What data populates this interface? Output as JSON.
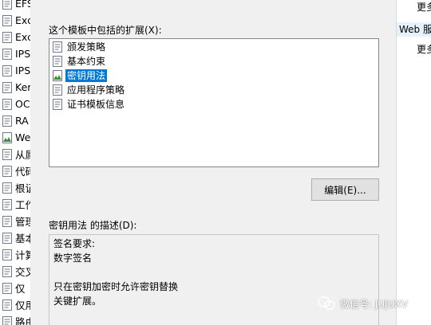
{
  "left_list": {
    "items": [
      {
        "label": "EFS",
        "icon": "certificate-template-icon"
      },
      {
        "label": "Exc",
        "icon": "certificate-template-icon"
      },
      {
        "label": "Exc",
        "icon": "certificate-template-icon"
      },
      {
        "label": "IPS",
        "icon": "certificate-template-icon"
      },
      {
        "label": "IPS",
        "icon": "certificate-template-icon"
      },
      {
        "label": "Ker",
        "icon": "certificate-template-icon"
      },
      {
        "label": "OC",
        "icon": "certificate-template-icon"
      },
      {
        "label": "RA",
        "icon": "certificate-template-icon"
      },
      {
        "label": "We",
        "icon": "certificate-template-icon"
      },
      {
        "label": "从属",
        "icon": "certificate-template-icon"
      },
      {
        "label": "代码",
        "icon": "certificate-template-icon"
      },
      {
        "label": "根证",
        "icon": "certificate-template-icon"
      },
      {
        "label": "工作",
        "icon": "certificate-template-icon"
      },
      {
        "label": "管理",
        "icon": "certificate-template-icon"
      },
      {
        "label": "基本",
        "icon": "certificate-template-icon"
      },
      {
        "label": "计算",
        "icon": "certificate-template-icon"
      },
      {
        "label": "交叉",
        "icon": "certificate-template-icon"
      },
      {
        "label": "仅",
        "icon": "certificate-template-icon"
      },
      {
        "label": "仅用",
        "icon": "certificate-template-icon"
      },
      {
        "label": "路由",
        "icon": "certificate-template-icon"
      }
    ]
  },
  "dialog": {
    "extensions_label": "这个模板中包括的扩展(X):",
    "extensions": [
      {
        "label": "颁发策略",
        "selected": false
      },
      {
        "label": "基本约束",
        "selected": false
      },
      {
        "label": "密钥用法",
        "selected": true
      },
      {
        "label": "应用程序策略",
        "selected": false
      },
      {
        "label": "证书模板信息",
        "selected": false
      }
    ],
    "edit_button": "编辑(E)...",
    "description_label": "密钥用法 的描述(D):",
    "description_lines": [
      "签名要求:",
      "数字签名",
      "",
      "只在密钥加密时允许密钥替换",
      "关键扩展。"
    ]
  },
  "right_panel": {
    "texts": [
      "更多",
      "Web 服",
      "更多"
    ]
  },
  "watermark": {
    "text": "微信号: JUJUXV"
  },
  "colors": {
    "selection": "#0078d7",
    "dialog_bg": "#f0f0f0"
  }
}
